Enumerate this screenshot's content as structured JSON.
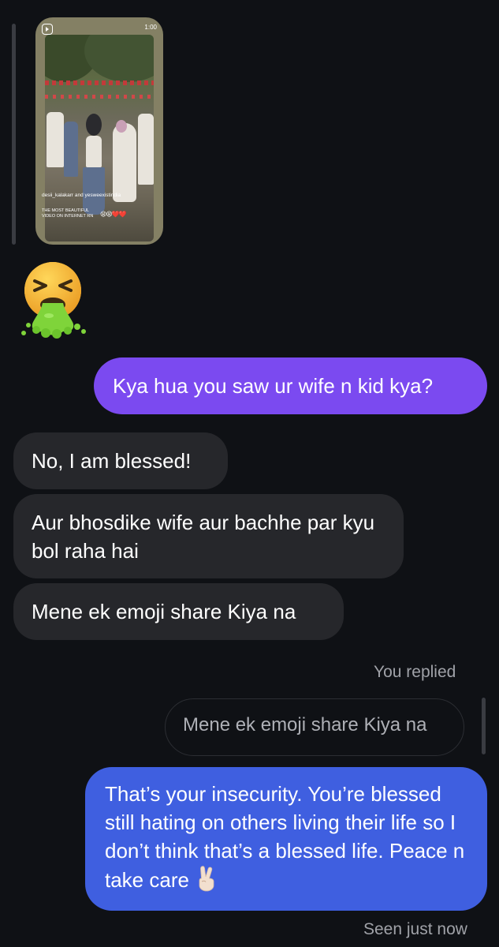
{
  "shared_reel": {
    "duration": "1:00",
    "author": "desii_kalakarr and yesweexistindia",
    "caption": "THE MOST BEAUTIFUL VIDEO ON INTERNET RN",
    "caption_emoji": "😫😫❤️❤️"
  },
  "reaction_emoji": "nauseated/vomiting face",
  "messages": {
    "sent_1": "Kya hua you saw ur wife n kid kya?",
    "received_1": "No, I am blessed!",
    "received_2": "Aur bhosdike wife aur bachhe par kyu bol raha hai",
    "received_3": "Mene ek emoji share Kiya na",
    "you_replied_label": "You replied",
    "quoted_reply": "Mene ek emoji share Kiya na",
    "sent_2": "That’s your insecurity. You’re blessed still hating on others living their life so I don’t think that’s a blessed life. Peace n take care",
    "seen_status": "Seen just now"
  },
  "colors": {
    "background": "#0f1115",
    "sent_purple": "#7b4af0",
    "sent_blue": "#3f5fe0",
    "received_gray": "#26272b"
  }
}
